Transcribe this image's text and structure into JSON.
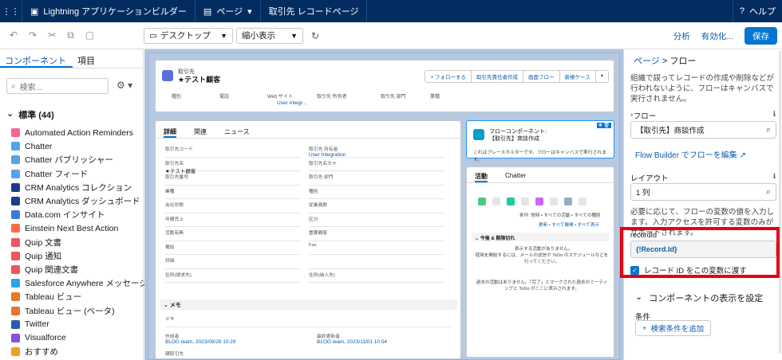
{
  "topbar": {
    "app_title": "Lightning アプリケーションビルダー",
    "page_menu": "ページ",
    "page_name": "取引先 レコードページ",
    "help": "ヘルプ"
  },
  "toolbar": {
    "device": "デスクトップ",
    "view": "縮小表示",
    "analyze": "分析",
    "activate": "有効化...",
    "save": "保存"
  },
  "left": {
    "tabs": [
      "コンポーネント",
      "項目"
    ],
    "search_placeholder": "検索...",
    "section": "標準 (44)",
    "components": [
      {
        "label": "Automated Action Reminders",
        "color": "#f26891"
      },
      {
        "label": "Chatter",
        "color": "#54a4e8"
      },
      {
        "label": "Chatter パブリッシャー",
        "color": "#54a4e8"
      },
      {
        "label": "Chatter フィード",
        "color": "#54a4e8"
      },
      {
        "label": "CRM Analytics コレクション",
        "color": "#1e3a8a"
      },
      {
        "label": "CRM Analytics ダッシュボード",
        "color": "#1e3a8a"
      },
      {
        "label": "Data.com インサイト",
        "color": "#3a7bd5"
      },
      {
        "label": "Einstein Next Best Action",
        "color": "#ff6b4a"
      },
      {
        "label": "Quip 文書",
        "color": "#f2545b"
      },
      {
        "label": "Quip 通知",
        "color": "#f2545b"
      },
      {
        "label": "Quip 関連文書",
        "color": "#f2545b"
      },
      {
        "label": "Salesforce Anywhere メッセージ",
        "color": "#2ea3f2"
      },
      {
        "label": "Tableau ビュー",
        "color": "#e8762d"
      },
      {
        "label": "Tableau ビュー (ベータ)",
        "color": "#e8762d"
      },
      {
        "label": "Twitter",
        "color": "#2a5ca8"
      },
      {
        "label": "Visualforce",
        "color": "#8a4fd8"
      },
      {
        "label": "おすすめ",
        "color": "#f0a020"
      }
    ]
  },
  "canvas": {
    "header": {
      "object": "取引先",
      "name": "★テスト顧客",
      "buttons": [
        "+ フォローする",
        "取引先責任者作成",
        "画面フロー",
        "新規ケース"
      ],
      "fields": [
        "種別",
        "電話",
        "Web サイト",
        "取引先 所有者",
        "取引先 部門",
        "業種"
      ],
      "owner_value": "User Integr..."
    },
    "detail": {
      "tabs": [
        "詳細",
        "関連",
        "ニュース"
      ],
      "rows": [
        [
          {
            "label": "取引先コード",
            "value": ""
          },
          {
            "label": "取引先 所有者",
            "value": "User Integration"
          }
        ],
        [
          {
            "label": "取引先名",
            "value": "★テスト顧客"
          },
          {
            "label": "取引先名カナ",
            "value": ""
          }
        ],
        [
          {
            "label": "取引先番号",
            "value": ""
          },
          {
            "label": "取引先 部門",
            "value": ""
          }
        ],
        [
          {
            "label": "業種",
            "value": ""
          },
          {
            "label": "種別",
            "value": ""
          }
        ],
        [
          {
            "label": "会社形態",
            "value": ""
          },
          {
            "label": "従業員数",
            "value": ""
          }
        ],
        [
          {
            "label": "年間売上",
            "value": ""
          },
          {
            "label": "区分",
            "value": ""
          }
        ],
        [
          {
            "label": "活動有無",
            "value": ""
          },
          {
            "label": "重要顧客",
            "value": ""
          }
        ],
        [
          {
            "label": "電話",
            "value": ""
          },
          {
            "label": "Fax",
            "value": ""
          }
        ],
        [
          {
            "label": "評価",
            "value": ""
          },
          {
            "label": "",
            "value": ""
          }
        ],
        [
          {
            "label": "住所(請求先)",
            "value": ""
          },
          {
            "label": "住所(納入先)",
            "value": ""
          }
        ]
      ],
      "memo_title": "メモ",
      "memo_label": "メモ",
      "created_label": "作成者",
      "created_value": "BLOG team, 2023/09/28 10:29",
      "modified_label": "最終更新者",
      "modified_value": "BLOG team, 2023/11/01 10:54",
      "owner_label": "親取引先"
    },
    "flow": {
      "title1": "フローコンポーネント:",
      "title2": "【取引先】商談作成",
      "note": "これはプレースホルダーです。フローはキャンバスで実行されます。"
    },
    "activity": {
      "tabs": [
        "活動",
        "Chatter"
      ],
      "filter": "条件: 常時 • すべての活動 • すべての種別",
      "links": "更新 • すべて展開 • すべて表示",
      "upcoming": "今後 & 期限切れ",
      "empty1": "表示する活動がありません。",
      "empty2": "使用を開始するには、メールの送信や ToDo のスケジュールなどを行ってください。",
      "past": "過去の活動はありません。「完了」とマークされた過去のミーティングと ToDo がここに表示されます。"
    }
  },
  "right": {
    "breadcrumb_page": "ページ",
    "breadcrumb_sep": ">",
    "breadcrumb_cur": "フロー",
    "desc": "組織で誤ってレコードの作成や削除などが行われないように、フローはキャンバスで実行されません。",
    "flow_label": "フロー",
    "flow_value": "【取引先】商談作成",
    "flow_builder_link": "Flow Builder でフローを編集",
    "layout_label": "レイアウト",
    "layout_value": "1 列",
    "vars_desc": "必要に応じて、フローの変数の値を入力します。入力アクセスを許可する変数のみがサポートされます。",
    "record_label": "recordId",
    "record_value": "{!Record.Id}",
    "pass_id": "レコード ID をこの変数に渡す",
    "visibility": "コンポーネントの表示を設定",
    "condition": "条件",
    "add_filter": "検索条件を追加"
  }
}
